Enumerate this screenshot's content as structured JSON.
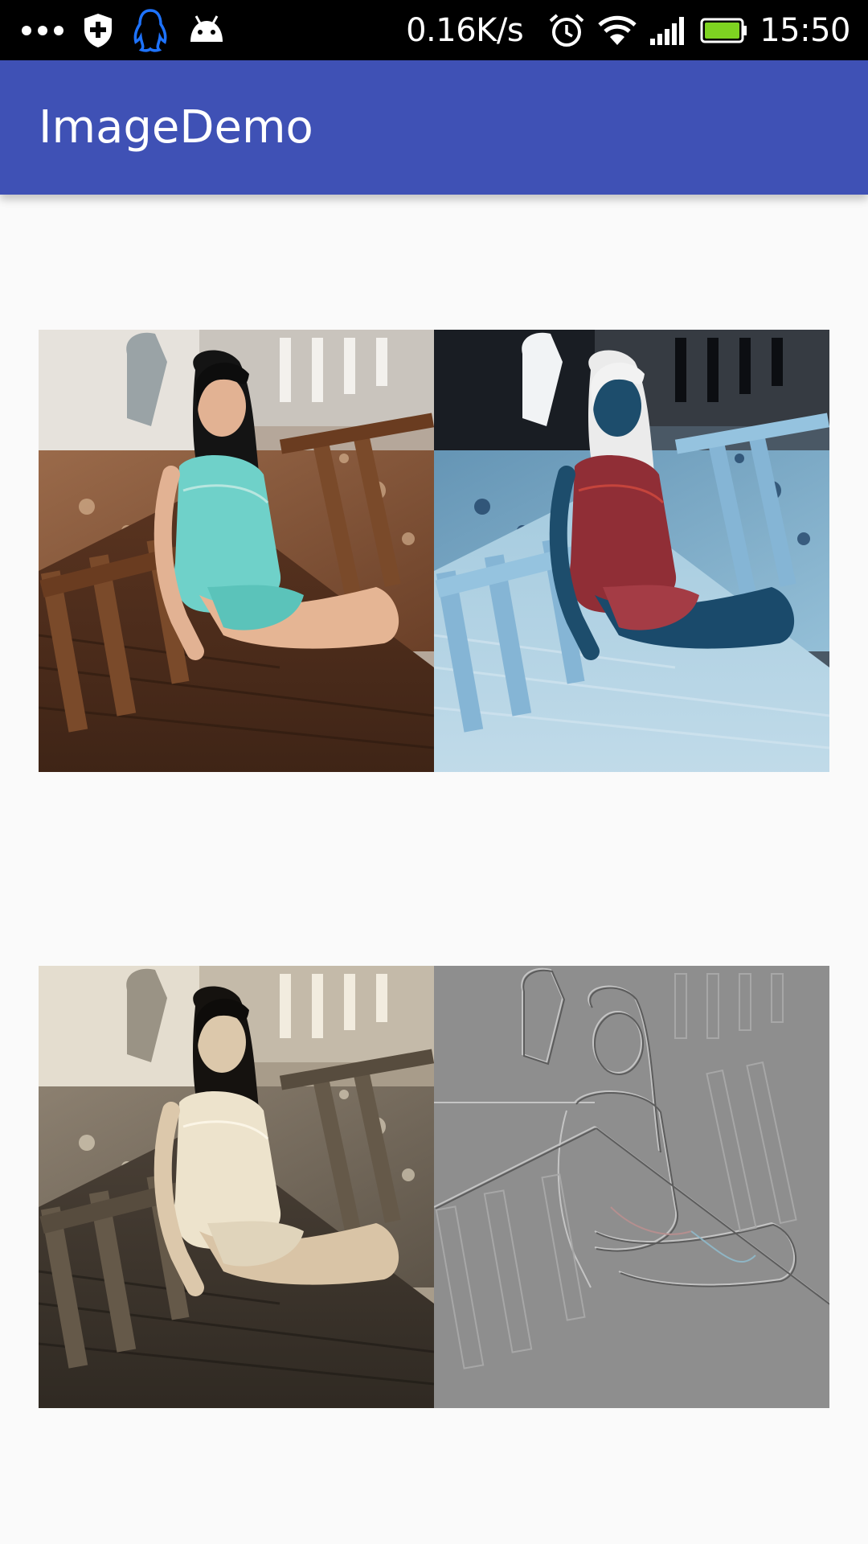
{
  "status_bar": {
    "network_speed": "0.16K/s",
    "time": "15:50",
    "icons": [
      "more-dots-icon",
      "shield-icon",
      "qq-penguin-icon",
      "android-icon",
      "alarm-clock-icon",
      "wifi-icon",
      "signal-icon",
      "battery-icon"
    ],
    "battery_color": "#7ed321"
  },
  "app_bar": {
    "title": "ImageDemo",
    "color": "#3f51b5"
  },
  "images": [
    {
      "name": "original-photo",
      "filter": "original"
    },
    {
      "name": "negative-photo",
      "filter": "invert"
    },
    {
      "name": "sepia-photo",
      "filter": "sepia"
    },
    {
      "name": "emboss-photo",
      "filter": "emboss"
    }
  ]
}
